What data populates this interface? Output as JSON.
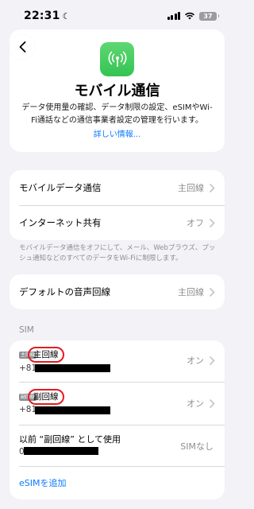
{
  "status": {
    "time": "22:31",
    "battery": "37"
  },
  "header": {
    "title": "モバイル通信",
    "description": "データ使用量の確認、データ制限の設定、eSIMやWi-Fi通話などの通信事業者設定の管理を行います。",
    "learn_more": "詳しい情報..."
  },
  "group1": {
    "cellular_data": {
      "label": "モバイルデータ通信",
      "value": "主回線"
    },
    "hotspot": {
      "label": "インターネット共有",
      "value": "オフ"
    },
    "footnote": "モバイルデータ通信をオフにして、メール、Webブラウズ、プッシュ通知などのすべてのデータをWi-Fiに制限します。"
  },
  "group2": {
    "default_voice": {
      "label": "デフォルトの音声回線",
      "value": "主回線"
    }
  },
  "sim": {
    "header": "SIM",
    "primary": {
      "badge": "主回線",
      "name": "主回線",
      "prefix": "+81",
      "value": "オン"
    },
    "secondary": {
      "badge": "副回線",
      "name": "副回線",
      "prefix": "+81",
      "value": "オン"
    },
    "previous": {
      "label": "以前 “副回線” として使用",
      "prefix": "0",
      "value": "SIMなし"
    },
    "add_esim": "eSIMを追加"
  }
}
